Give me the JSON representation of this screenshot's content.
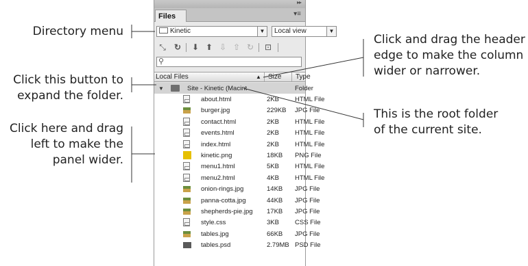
{
  "panel": {
    "tab_label": "Files",
    "menu_glyph": "▾≡",
    "collapse_glyph": "▸▸",
    "site_dropdown": "Kinetic",
    "view_dropdown": "Local view",
    "search_glyph": "⚲",
    "columns": {
      "local_files": "Local Files",
      "sort_glyph": "▲",
      "size": "Size",
      "type": "Type"
    },
    "root": {
      "name": "Site - Kinetic (Macint",
      "type": "Folder"
    },
    "files": [
      {
        "name": "about.html",
        "size": "2KB",
        "type": "HTML File",
        "icon": "html-file-icon"
      },
      {
        "name": "burger.jpg",
        "size": "229KB",
        "type": "JPG File",
        "icon": "jpg-file-icon"
      },
      {
        "name": "contact.html",
        "size": "2KB",
        "type": "HTML File",
        "icon": "html-file-icon"
      },
      {
        "name": "events.html",
        "size": "2KB",
        "type": "HTML File",
        "icon": "html-file-icon"
      },
      {
        "name": "index.html",
        "size": "2KB",
        "type": "HTML File",
        "icon": "html-file-icon"
      },
      {
        "name": "kinetic.png",
        "size": "18KB",
        "type": "PNG File",
        "icon": "png-file-icon"
      },
      {
        "name": "menu1.html",
        "size": "5KB",
        "type": "HTML File",
        "icon": "html-file-icon"
      },
      {
        "name": "menu2.html",
        "size": "4KB",
        "type": "HTML File",
        "icon": "html-file-icon"
      },
      {
        "name": "onion-rings.jpg",
        "size": "14KB",
        "type": "JPG File",
        "icon": "jpg-file-icon"
      },
      {
        "name": "panna-cotta.jpg",
        "size": "44KB",
        "type": "JPG File",
        "icon": "jpg-file-icon"
      },
      {
        "name": "shepherds-pie.jpg",
        "size": "17KB",
        "type": "JPG File",
        "icon": "jpg-file-icon"
      },
      {
        "name": "style.css",
        "size": "3KB",
        "type": "CSS File",
        "icon": "css-file-icon"
      },
      {
        "name": "tables.jpg",
        "size": "66KB",
        "type": "JPG File",
        "icon": "jpg-file-icon"
      },
      {
        "name": "tables.psd",
        "size": "2.79MB",
        "type": "PSD File",
        "icon": "psd-file-icon"
      }
    ]
  },
  "toolbar_icons": [
    "connect-icon",
    "refresh-icon",
    "get-files-icon",
    "put-files-icon",
    "check-out-icon",
    "check-in-icon",
    "sync-icon",
    "expand-panel-icon"
  ],
  "callouts": {
    "directory_menu": [
      "Directory menu"
    ],
    "expand_button": [
      "Click this button to",
      "expand the folder."
    ],
    "drag_panel": [
      "Click here and drag",
      "left to make the",
      "panel wider."
    ],
    "drag_header": [
      "Click and drag the header",
      "edge to make the column",
      "wider or narrower."
    ],
    "root_folder": [
      "This is the root folder",
      "of the current site."
    ]
  }
}
